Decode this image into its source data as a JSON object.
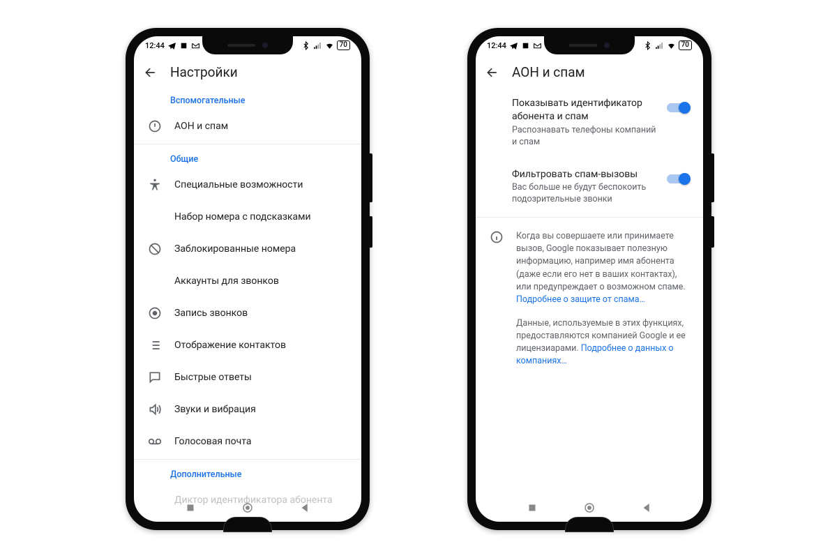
{
  "status": {
    "time": "12:44",
    "battery": "70"
  },
  "left_phone": {
    "title": "Настройки",
    "section_assist": "Вспомогательные",
    "item_aon": "АОН и спам",
    "section_general": "Общие",
    "item_access": "Специальные возможности",
    "item_dial": "Набор номера с подсказками",
    "item_blocked": "Заблокированные номера",
    "item_accounts": "Аккаунты для звонков",
    "item_record": "Запись звонков",
    "item_display": "Отображение контактов",
    "item_quick": "Быстрые ответы",
    "item_sound": "Звуки и вибрация",
    "item_voicemail": "Голосовая почта",
    "section_extra": "Дополнительные",
    "item_announce": "Диктор идентификатора абонента"
  },
  "right_phone": {
    "title": "АОН и спам",
    "setting1_title": "Показывать идентификатор абонента и спам",
    "setting1_sub": "Распознавать телефоны компаний и спам",
    "setting2_title": "Фильтровать спам-вызовы",
    "setting2_sub": "Вас больше не будут беспокоить подозрительные звонки",
    "info_p1": "Когда вы совершаете или принимаете вызов, Google показывает полезную информацию, например имя абонента (даже если его нет в ваших контактах), или предупреждает о возможном спаме. ",
    "info_link1": "Подробнее о защите от спама…",
    "info_p2": "Данные, используемые в этих функциях, предоставляются компанией Google и ее лицензиарами. ",
    "info_link2": "Подробнее о данных о компаниях…"
  }
}
